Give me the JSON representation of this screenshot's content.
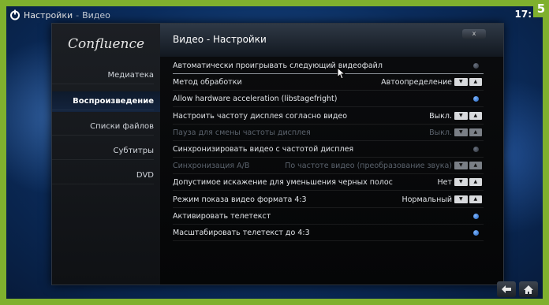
{
  "header": {
    "title": "Настройки",
    "separator": "-",
    "subtitle": "Видео",
    "clock": "17:",
    "badge": "5"
  },
  "sidebar": {
    "logo": "Confluence",
    "items": [
      {
        "label": "Медиатека",
        "active": false
      },
      {
        "label": "Воспроизведение",
        "active": true
      },
      {
        "label": "Списки файлов",
        "active": false
      },
      {
        "label": "Субтитры",
        "active": false
      },
      {
        "label": "DVD",
        "active": false
      }
    ]
  },
  "dialog": {
    "title": "Видео - Настройки",
    "close_label": "x"
  },
  "settings": [
    {
      "label": "Автоматически проигрывать следующий видеофайл",
      "value": "",
      "control": "toggle",
      "on": false,
      "disabled": false
    },
    {
      "label": "Метод обработки",
      "value": "Автоопределение",
      "control": "spin",
      "disabled": false
    },
    {
      "label": "Allow hardware acceleration (libstagefright)",
      "value": "",
      "control": "toggle",
      "on": true,
      "disabled": false
    },
    {
      "label": "Настроить частоту дисплея согласно видео",
      "value": "Выкл.",
      "control": "spin",
      "disabled": false
    },
    {
      "label": "Пауза для смены частоты дисплея",
      "value": "Выкл.",
      "control": "spin",
      "disabled": true
    },
    {
      "label": "Синхронизировать видео с частотой дисплея",
      "value": "",
      "control": "toggle",
      "on": false,
      "disabled": false
    },
    {
      "label": "Синхронизация A/B",
      "value": "По частоте видео (преобразование звука)",
      "control": "spin",
      "disabled": true
    },
    {
      "label": "Допустимое искажение для уменьшения черных полос",
      "value": "Нет",
      "control": "spin",
      "disabled": false
    },
    {
      "label": "Режим показа видео формата 4:3",
      "value": "Нормальный",
      "control": "spin",
      "disabled": false
    },
    {
      "label": "Активировать телетекст",
      "value": "",
      "control": "toggle",
      "on": true,
      "disabled": false
    },
    {
      "label": "Масштабировать телетекст до 4:3",
      "value": "",
      "control": "toggle",
      "on": true,
      "disabled": false
    }
  ],
  "icons": {
    "power": "power-icon",
    "back": "back-arrow-icon",
    "home": "home-icon",
    "spin_down": "chevron-down-icon",
    "spin_up": "chevron-up-icon",
    "cursor": "mouse-cursor-icon"
  },
  "colors": {
    "accent_green": "#7fb02e",
    "toggle_on": "#3b86e8",
    "background_blue": "#0b2d5e"
  }
}
